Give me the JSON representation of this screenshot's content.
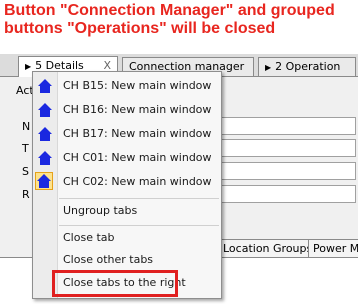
{
  "annotation": {
    "line1": "Button \"Connection Manager\" and grouped",
    "line2": "buttons \"Operations\" will be closed",
    "color": "#e8261f"
  },
  "tabs": [
    {
      "label": "5 Details",
      "close": "X",
      "arrow": "▶"
    },
    {
      "label": "Connection manager"
    },
    {
      "label": "2 Operation",
      "arrow": "▶"
    }
  ],
  "left_labels": [
    "Act",
    "N",
    "T",
    "S",
    "R"
  ],
  "subtabs": [
    "Location Groups",
    "Power M"
  ],
  "menu": {
    "items": [
      {
        "label": "CH B15: New main window",
        "icon": "house-icon"
      },
      {
        "label": "CH B16: New main window",
        "icon": "house-icon"
      },
      {
        "label": "CH B17: New main window",
        "icon": "house-icon"
      },
      {
        "label": "CH C01: New main window",
        "icon": "house-icon"
      },
      {
        "label": "CH C02: New main window",
        "icon": "house-icon",
        "highlighted": true
      }
    ],
    "ungroup": "Ungroup tabs",
    "close_tab": "Close tab",
    "close_other": "Close other tabs",
    "close_right": "Close tabs to the right"
  },
  "colors": {
    "icon_blue": "#1a28e0",
    "highlight_box": "#e02020"
  }
}
